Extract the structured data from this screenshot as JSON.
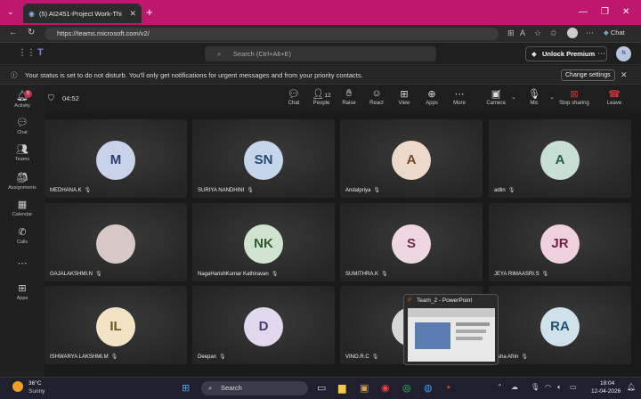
{
  "browser": {
    "tab_title": "(5) AI2451-Project Work-Thi",
    "url": "https://teams.microsoft.com/v2/"
  },
  "teams": {
    "search_placeholder": "Search (Ctrl+Alt+E)",
    "unlock_label": "Unlock Premium",
    "chat_label": "Chat"
  },
  "notification": {
    "text": "Your status is set to do not disturb. You'll only get notifications for urgent messages and from your priority contacts.",
    "change_settings": "Change settings"
  },
  "rail": [
    {
      "label": "Activity",
      "badge": "5"
    },
    {
      "label": "Chat"
    },
    {
      "label": "Teams"
    },
    {
      "label": "Assignments"
    },
    {
      "label": "Calendar"
    },
    {
      "label": "Calls"
    },
    {
      "label": "Apps"
    }
  ],
  "meeting": {
    "timer": "04:52",
    "people_count": "12",
    "buttons": [
      "Chat",
      "People",
      "Raise",
      "React",
      "View",
      "Apps",
      "More",
      "Camera",
      "Mic",
      "Stop sharing",
      "Leave"
    ]
  },
  "participants": [
    {
      "initials": "M",
      "name": "MEDHANA.K",
      "color": "#c8d3ea",
      "text": "#2b3f6e"
    },
    {
      "initials": "SN",
      "name": "SURIYA NANDHINI",
      "color": "#c5d6ea",
      "text": "#254a72"
    },
    {
      "initials": "A",
      "name": "Andalpriya",
      "color": "#ecd9c9",
      "text": "#6e4a2c"
    },
    {
      "initials": "A",
      "name": "adlin",
      "color": "#c7e0d4",
      "text": "#2c5a44"
    },
    {
      "initials": "",
      "name": "GAJALAKSHMI.N",
      "color": "#d8c8c8",
      "text": "#333"
    },
    {
      "initials": "NK",
      "name": "NagaHarishKumar Kathiravan",
      "color": "#cfe3cf",
      "text": "#2f5a32"
    },
    {
      "initials": "S",
      "name": "SUMITHRA.K",
      "color": "#efd7e1",
      "text": "#6e2d48"
    },
    {
      "initials": "JR",
      "name": "JEYA RIMAASRI.S",
      "color": "#efd0dd",
      "text": "#6e2445"
    },
    {
      "initials": "IL",
      "name": "ISHWARYA LAKSHMI.M",
      "color": "#f1e3c3",
      "text": "#6b5420"
    },
    {
      "initials": "D",
      "name": "Deepan",
      "color": "#e1d8ee",
      "text": "#4a3a6e"
    },
    {
      "initials": "",
      "name": "VINO.R.C",
      "color": "#d6d6d6",
      "text": "#333"
    },
    {
      "initials": "RA",
      "name": "Asha Afrin",
      "color": "#cfe1ea",
      "text": "#22506a"
    }
  ],
  "ppt_preview": {
    "title": "Team_2 - PowerPoint"
  },
  "taskbar": {
    "weather_temp": "36°C",
    "weather_desc": "Sunny",
    "search_label": "Search",
    "time": "18:04",
    "date": "12-04-2026"
  }
}
